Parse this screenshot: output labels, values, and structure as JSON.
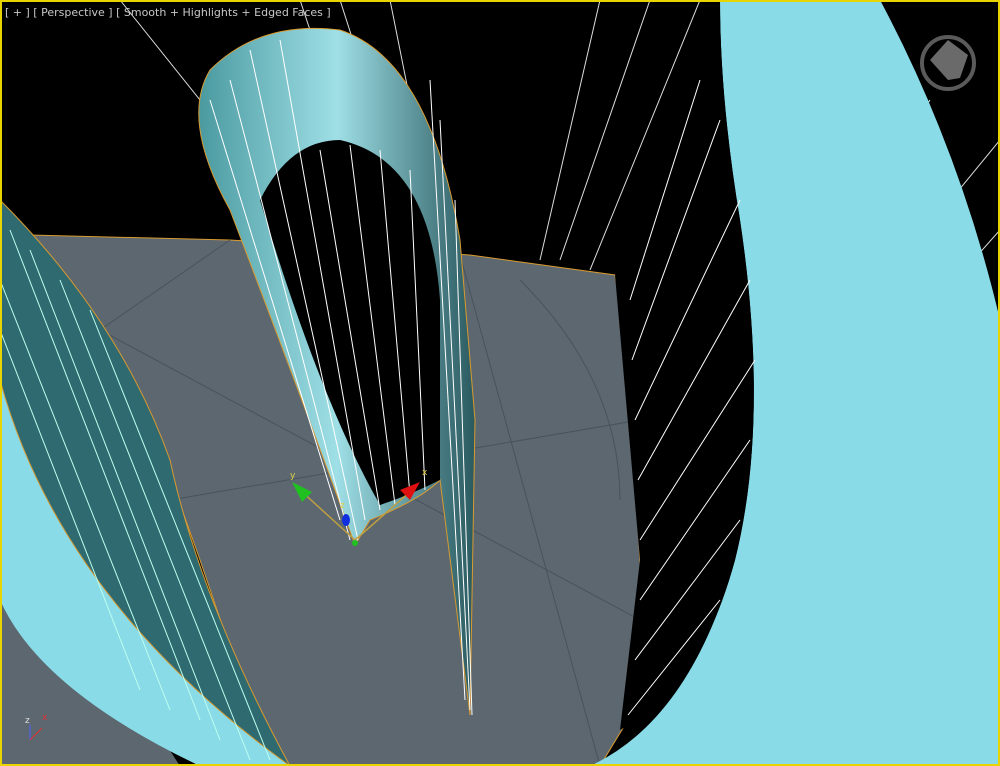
{
  "viewport": {
    "label_menu": "[ + ]",
    "label_view": "[ Perspective ]",
    "label_shading": "[ Smooth + Highlights + Edged Faces ]",
    "active_border_color": "#e8d400",
    "background_color": "#000000"
  },
  "scene": {
    "ground_color": "#5c6770",
    "surface_color": "#8adbe8",
    "shell_color": "#2f6a70",
    "wire_color": "#ffffff",
    "selection_edge_color": "#d89a30"
  },
  "gizmo": {
    "x_label": "x",
    "y_label": "y",
    "z_label": "z"
  },
  "corner_axes": {
    "z_label": "z",
    "x_label": "x"
  },
  "viewcube": {
    "icon": "viewcube-icon"
  }
}
